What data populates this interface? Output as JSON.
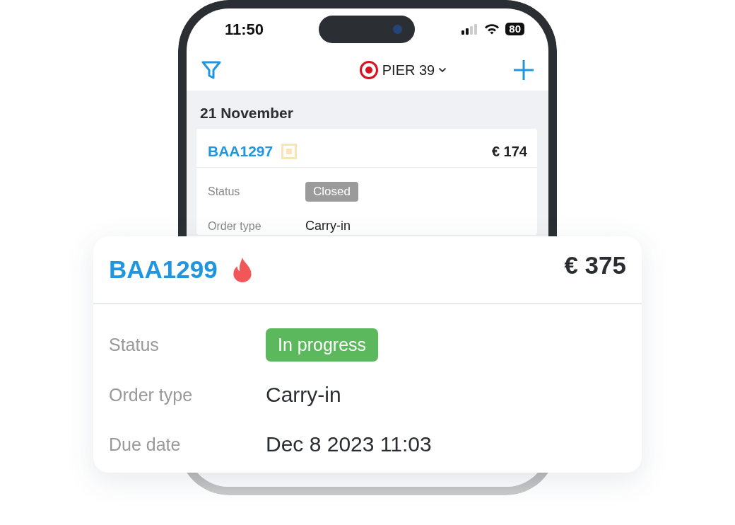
{
  "status_bar": {
    "time": "11:50",
    "battery": "80"
  },
  "header": {
    "location": "PIER 39"
  },
  "date_heading": "21 November",
  "order": {
    "number": "BAA1297",
    "price": "€ 174",
    "fields": [
      {
        "label": "Status",
        "value": "Closed",
        "kind": "badge",
        "color": "#9b9b9b"
      },
      {
        "label": "Order type",
        "value": "Carry-in",
        "kind": "text"
      }
    ]
  },
  "highlighted_order": {
    "number": "BAA1299",
    "price": "€ 375",
    "fields": [
      {
        "label": "Status",
        "value": "In progress",
        "kind": "badge",
        "color": "#5cb85c"
      },
      {
        "label": "Order type",
        "value": "Carry-in",
        "kind": "text"
      },
      {
        "label": "Due date",
        "value": "Dec 8 2023 11:03",
        "kind": "text"
      }
    ]
  }
}
